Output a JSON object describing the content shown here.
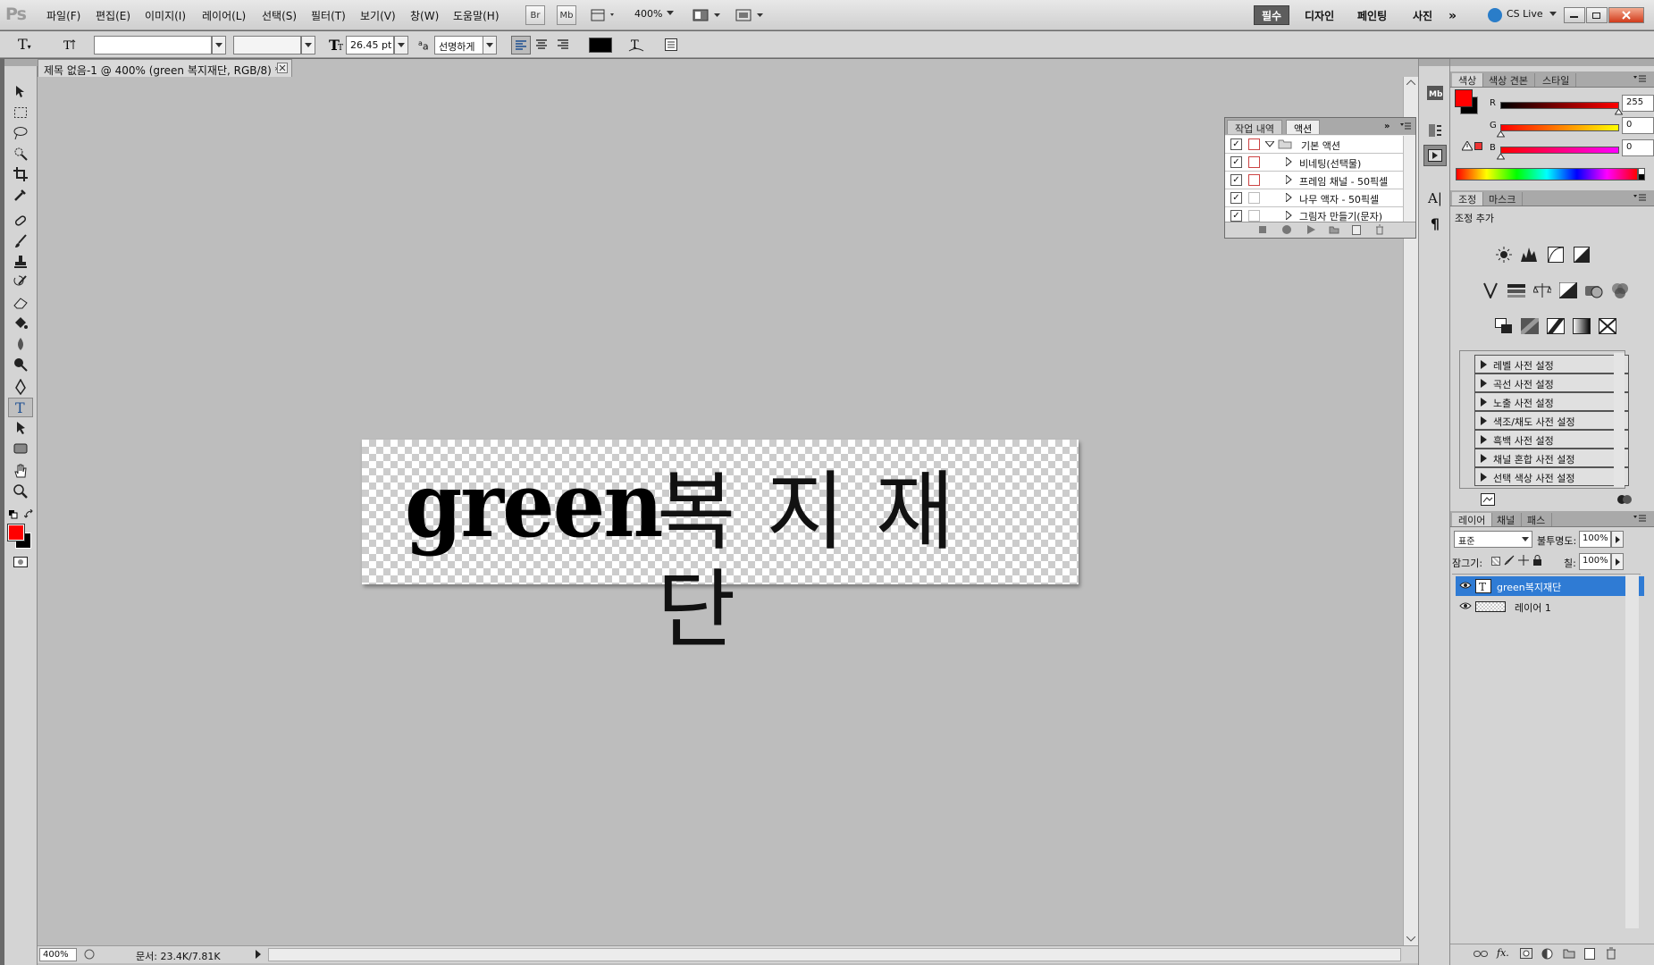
{
  "app": {
    "logo": "Ps"
  },
  "menu": [
    "파일(F)",
    "편집(E)",
    "이미지(I)",
    "레이어(L)",
    "선택(S)",
    "필터(T)",
    "보기(V)",
    "창(W)",
    "도움말(H)"
  ],
  "appbar": {
    "bridge": "Br",
    "minibridge": "Mb",
    "zoom": "400%"
  },
  "workspaces": [
    "필수",
    "디자인",
    "페인팅",
    "사진"
  ],
  "cslive": "CS Live",
  "options": {
    "font_family": "",
    "font_style": "",
    "font_size": "26.45 pt",
    "antialias": "선명하게",
    "color": "#000000"
  },
  "document": {
    "tab_title": "제목 없음-1 @ 400% (green 복지재단, RGB/8) *",
    "canvas_text_latin": "green",
    "canvas_text_korean": "복지재단"
  },
  "status": {
    "zoom": "400%",
    "doc_info": "문서: 23.4K/7.81K"
  },
  "history_panel": {
    "tabs": [
      "작업 내역",
      "액션"
    ],
    "active_tab": "액션",
    "set_name": "기본 액션",
    "actions": [
      "비네팅(선택물)",
      "프레임 채널 - 50픽셀",
      "나무 액자 - 50픽셀",
      "그림자 만들기(문자)"
    ]
  },
  "color_panel": {
    "tabs": [
      "색상",
      "색상 견본",
      "스타일"
    ],
    "r_label": "R",
    "g_label": "G",
    "b_label": "B",
    "r": "255",
    "g": "0",
    "b": "0",
    "fg_color": "#ff0000",
    "bg_color": "#000000"
  },
  "adjust_panel": {
    "tabs": [
      "조정",
      "마스크"
    ],
    "title": "조정 추가",
    "presets": [
      "레벨 사전 설정",
      "곡선 사전 설정",
      "노출 사전 설정",
      "색조/채도 사전 설정",
      "흑백 사전 설정",
      "채널 혼합 사전 설정",
      "선택 색상 사전 설정"
    ]
  },
  "layers_panel": {
    "tabs": [
      "레이어",
      "채널",
      "패스"
    ],
    "blend_mode": "표준",
    "opacity_label": "불투명도:",
    "opacity": "100%",
    "lock_label": "잠그기:",
    "fill_label": "칠:",
    "fill": "100%",
    "layers": [
      {
        "name": "green복지재단",
        "type": "text",
        "selected": true
      },
      {
        "name": "레이어 1",
        "type": "pixel",
        "selected": false
      }
    ]
  }
}
